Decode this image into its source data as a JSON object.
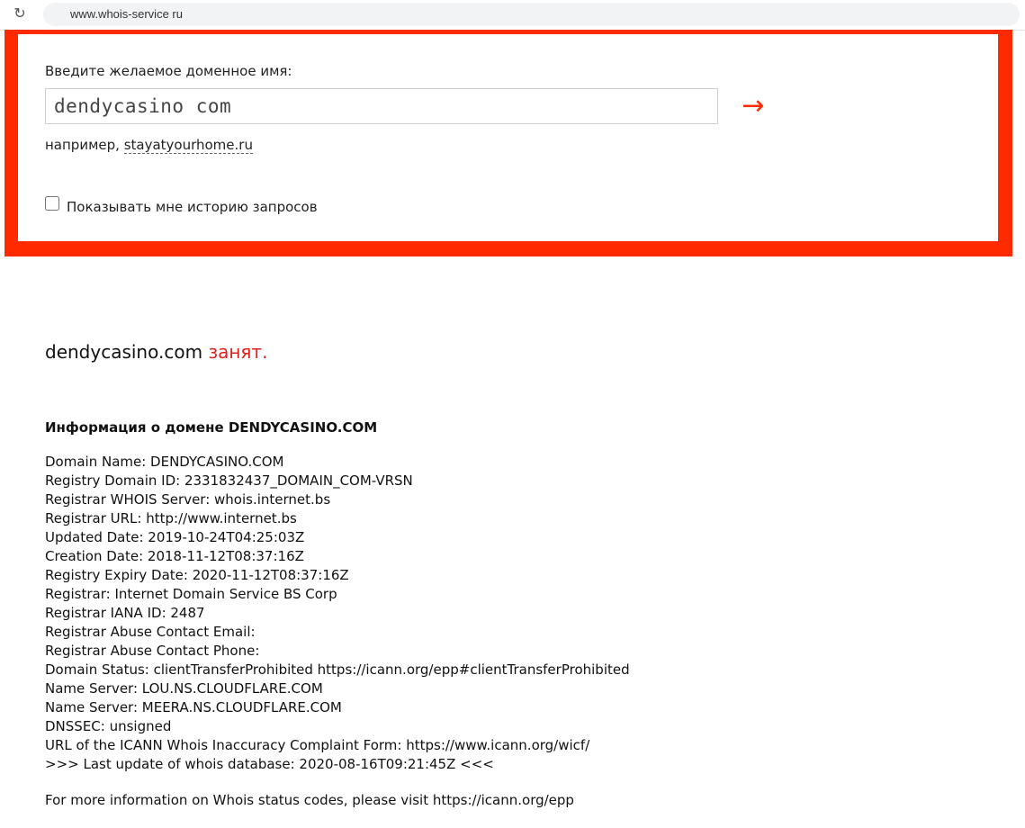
{
  "browser": {
    "reload_icon": "↻",
    "url": "www.whois-service ru"
  },
  "search": {
    "prompt_label": "Введите желаемое доменное имя:",
    "input_value": "dendycasino com",
    "submit_glyph": "→",
    "example_prefix": "например, ",
    "example_link": "stayatyourhome.ru",
    "history_label": "Показывать мне историю запросов",
    "history_checked": false
  },
  "result": {
    "domain": "dendycasino.com",
    "status": "занят.",
    "info_title": "Информация о домене DENDYCASINO.COM",
    "whois_lines": [
      "Domain Name: DENDYCASINO.COM",
      "Registry Domain ID: 2331832437_DOMAIN_COM-VRSN",
      "Registrar WHOIS Server: whois.internet.bs",
      "Registrar URL: http://www.internet.bs",
      "Updated Date: 2019-10-24T04:25:03Z",
      "Creation Date: 2018-11-12T08:37:16Z",
      "Registry Expiry Date: 2020-11-12T08:37:16Z",
      "Registrar: Internet Domain Service BS Corp",
      "Registrar IANA ID: 2487",
      "Registrar Abuse Contact Email:",
      "Registrar Abuse Contact Phone:",
      "Domain Status: clientTransferProhibited https://icann.org/epp#clientTransferProhibited",
      "Name Server: LOU.NS.CLOUDFLARE.COM",
      "Name Server: MEERA.NS.CLOUDFLARE.COM",
      "DNSSEC: unsigned",
      "URL of the ICANN Whois Inaccuracy Complaint Form: https://www.icann.org/wicf/",
      ">>> Last update of whois database: 2020-08-16T09:21:45Z <<<"
    ],
    "footer_note": "For more information on Whois status codes, please visit https://icann.org/epp"
  },
  "colors": {
    "accent": "#ff2a00",
    "status_taken": "#e0201a"
  }
}
